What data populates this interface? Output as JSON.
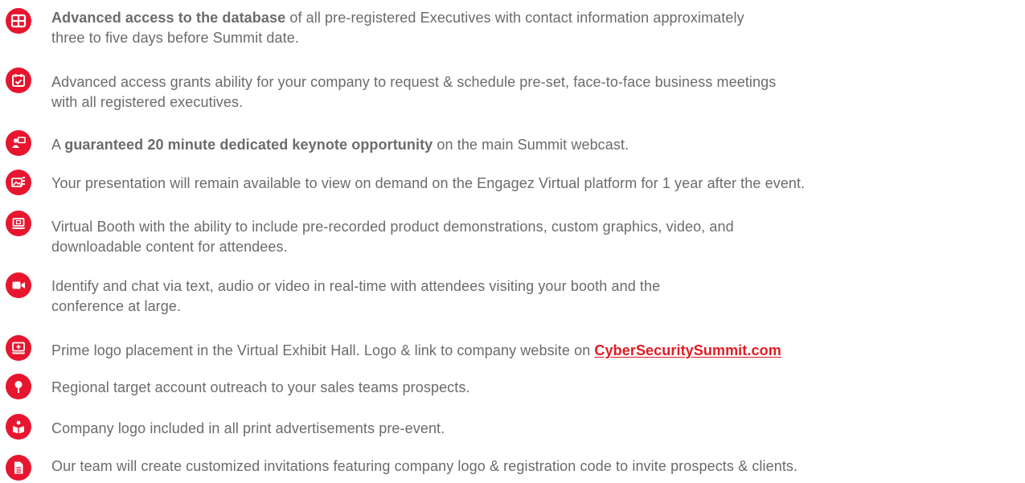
{
  "accent_color": "#e8152f",
  "text_color": "#6b6b6b",
  "features": [
    {
      "icon": "grid-icon",
      "line1_bold": "Advanced access to the database",
      "line1_rest": " of all pre-registered Executives with contact information approximately",
      "line2": "three to five days before Summit date."
    },
    {
      "icon": "calendar-check-icon",
      "line1": "Advanced access grants ability for your company to request & schedule pre-set, face-to-face business meetings",
      "line2": "with all registered executives."
    },
    {
      "icon": "presenter-icon",
      "prefix": "A ",
      "bold": "guaranteed 20 minute dedicated keynote opportunity",
      "suffix": " on the main Summit webcast."
    },
    {
      "icon": "media-gallery-icon",
      "line1": "Your presentation will remain available to view on demand on the Engagez Virtual platform for 1 year after the event."
    },
    {
      "icon": "laptop-play-icon",
      "line1": "Virtual Booth with the ability to include pre-recorded product demonstrations, custom graphics, video, and",
      "line2": "downloadable content for attendees."
    },
    {
      "icon": "video-camera-icon",
      "line1": "Identify and chat via text, audio or video in real-time with attendees visiting your booth and the",
      "line2": "conference at large."
    },
    {
      "icon": "monitor-icon",
      "text": "Prime logo placement in the Virtual Exhibit Hall. Logo & link to company website on ",
      "link": "CyberSecuritySummit.com"
    },
    {
      "icon": "map-pin-icon",
      "line1": "Regional target account outreach to your sales teams prospects."
    },
    {
      "icon": "gift-icon",
      "line1": "Company logo included in all print advertisements pre-event."
    },
    {
      "icon": "document-icon",
      "line1": "Our team will create customized invitations featuring company logo & registration code to invite prospects & clients."
    }
  ]
}
